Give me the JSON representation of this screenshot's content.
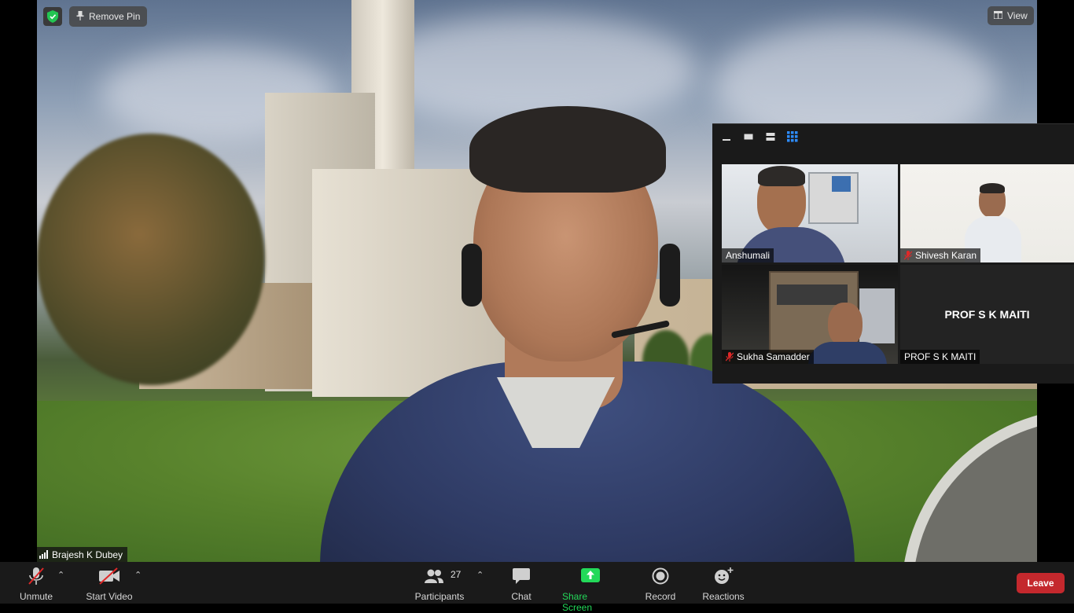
{
  "meeting": {
    "active_speaker": "Brajesh K Dubey",
    "remove_pin_label": "Remove Pin",
    "view_label": "View"
  },
  "gallery": {
    "participants": [
      {
        "name": "Anshumali",
        "muted": false
      },
      {
        "name": "Shivesh Karan",
        "muted": true
      },
      {
        "name": "Sukha Samadder",
        "muted": true
      },
      {
        "name": "PROF S K MAITI",
        "muted": false,
        "display_text": "PROF S K MAITI"
      }
    ]
  },
  "toolbar": {
    "unmute_label": "Unmute",
    "start_video_label": "Start Video",
    "participants_label": "Participants",
    "participants_count": "27",
    "chat_label": "Chat",
    "share_screen_label": "Share Screen",
    "record_label": "Record",
    "reactions_label": "Reactions",
    "leave_label": "Leave"
  },
  "colors": {
    "share_green": "#23d959",
    "leave_red": "#c4282d",
    "mute_red": "#e02828",
    "shield_green": "#23c552"
  }
}
